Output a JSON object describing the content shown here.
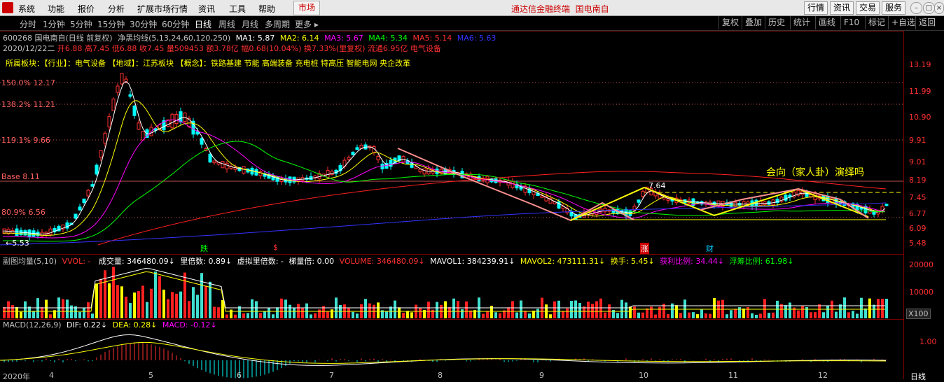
{
  "menu": {
    "items": [
      "系统",
      "功能",
      "报价",
      "分析",
      "扩展市场行情",
      "资讯",
      "工具",
      "帮助"
    ],
    "market_tab": "市场",
    "app_title": "通达信金融终端",
    "stock_title": "国电南自",
    "right_buttons": [
      "行情",
      "资讯",
      "交易",
      "服务"
    ]
  },
  "periods": {
    "items": [
      "分时",
      "1分钟",
      "5分钟",
      "15分钟",
      "30分钟",
      "60分钟",
      "日线",
      "周线",
      "月线",
      "多周期",
      "更多"
    ],
    "active": "日线",
    "right_buttons": [
      "复权",
      "叠加",
      "历史",
      "统计",
      "画线",
      "F10",
      "标记",
      "+自选",
      "返回"
    ]
  },
  "header": {
    "stock": "600268 国电南自(日线 前复权)",
    "indicator": "净黑均线(5,13,24,60,120,250)",
    "ma": [
      {
        "label": "MA1: 5.87",
        "color": "#ffffff"
      },
      {
        "label": "MA2: 6.14",
        "color": "#ffff00"
      },
      {
        "label": "MA3: 5.67",
        "color": "#ff00ff"
      },
      {
        "label": "MA4: 5.34",
        "color": "#00ff00"
      },
      {
        "label": "MA5: 5.14",
        "color": "#ff3030"
      },
      {
        "label": "MA6: 5.63",
        "color": "#3333ff"
      }
    ],
    "date": "2020/12/22二",
    "quote": "开6.88 高7.45 低6.88 收7.45 量509453 额3.78亿 幅0.68(10.04%) 换7.33%(里复权) 流通6.95亿 电气设备",
    "sector": "所属板块：【行业】：电气设备 【地域】：江苏板块 【概念】：铁路基建 节能 高端装备 充电桩 特高压 智能电网 央企改革"
  },
  "price_axis": [
    "13.19",
    "11.99",
    "10.90",
    "9.91",
    "9.01",
    "8.19",
    "7.45",
    "6.77",
    "6.09",
    "5.48"
  ],
  "fib_levels": [
    {
      "label": "150.0% 12.17",
      "value": 12.17
    },
    {
      "label": "138.2% 11.21",
      "value": 11.21
    },
    {
      "label": "119.1% 9.66",
      "value": 9.66
    },
    {
      "label": "Base 8.11",
      "value": 8.11
    },
    {
      "label": "80.9% 6.56",
      "value": 6.56
    }
  ],
  "annotations": {
    "low_price": "5.53",
    "mid_price": "7.64",
    "high_price": "13.19",
    "question": "会向（家人卦）演绎吗",
    "events": [
      {
        "text": "跌",
        "color": "#00ff00"
      },
      {
        "text": "$",
        "color": "#ff3030"
      },
      {
        "text": "涨",
        "color": "#ff3030"
      },
      {
        "text": "财",
        "color": "#00ccff"
      }
    ]
  },
  "volume_panel": {
    "title": "副图均量(5,10)",
    "fields": [
      {
        "label": "VVOL: -",
        "color": "#ff3030"
      },
      {
        "label": "成交量: 346480.09↓",
        "color": "#ffffff"
      },
      {
        "label": "里倍数: 0.89↓",
        "color": "#ffffff"
      },
      {
        "label": "虚拟里倍数: -",
        "color": "#ffffff"
      },
      {
        "label": "梯量倍: 0.00",
        "color": "#ffffff"
      },
      {
        "label": "VOLUME: 346480.09↓",
        "color": "#ff3030"
      },
      {
        "label": "MAVOL1: 384239.91↓",
        "color": "#ffffff"
      },
      {
        "label": "MAVOL2: 473111.31↓",
        "color": "#ffff00"
      },
      {
        "label": "换手: 5.45↓",
        "color": "#ffff00"
      },
      {
        "label": "获利比例: 34.44↓",
        "color": "#ff00ff"
      },
      {
        "label": "浮筹比例: 61.98↓",
        "color": "#00ff00"
      }
    ],
    "axis": [
      "20000",
      "10000"
    ],
    "unit": "X100"
  },
  "macd_panel": {
    "title": "MACD(12,26,9)",
    "fields": [
      {
        "label": "DIF: 0.22↓",
        "color": "#ffffff"
      },
      {
        "label": "DEA: 0.28↓",
        "color": "#ffff00"
      },
      {
        "label": "MACD: -0.12↓",
        "color": "#ff00ff"
      }
    ],
    "axis": [
      "1.00"
    ]
  },
  "date_axis": {
    "year": "2020年",
    "months": [
      "4",
      "5",
      "6",
      "7",
      "8",
      "9",
      "10",
      "11",
      "12"
    ],
    "period": "日线"
  },
  "colors": {
    "up": "#ff3030",
    "down": "#00ffff",
    "grid": "#7a0000",
    "ma_white": "#ffffff",
    "ma_yellow": "#ffff00",
    "ma_magenta": "#ff00ff",
    "ma_green": "#00ff00",
    "ma_red": "#ff2020",
    "ma_blue": "#3333ff"
  }
}
